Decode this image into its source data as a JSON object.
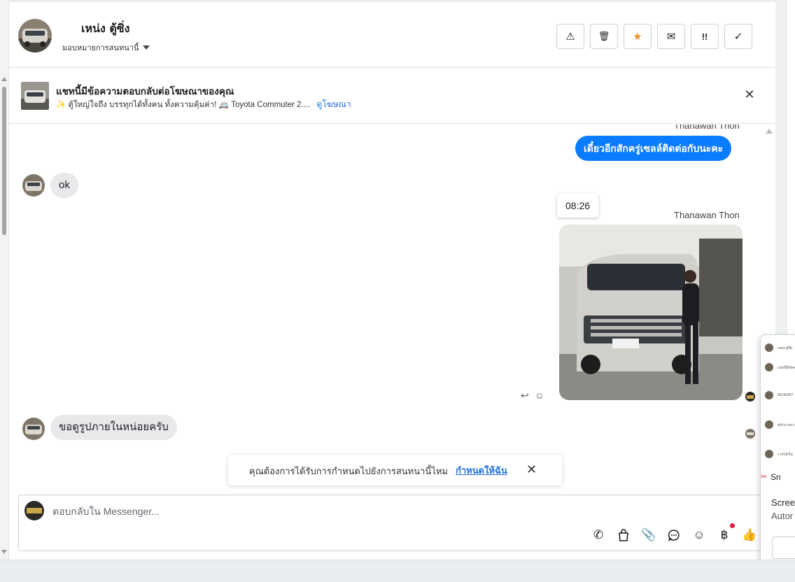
{
  "header": {
    "contact_name": "เหน่ง ตู้ซิ่ง",
    "assign_label": "มอบหมายการสนทนานี้"
  },
  "actions": {
    "spam_icon": "⚠",
    "delete_icon": "🗑",
    "star_icon": "★",
    "mark_unread_icon": "✉",
    "follow_up_icon": "!!",
    "done_icon": "✓"
  },
  "ad": {
    "title": "แชทนี้มีข้อความตอบกลับต่อโฆษณาของคุณ",
    "description": "✨ ตู้ใหญ่ใจถึง บรรทุกได้ทั้งคน ทั้งความคุ้มค่า! 🚐 Toyota Commuter 2....",
    "link": "ดูโฆษณา"
  },
  "messages": {
    "m1_sender": "Thanawan Thon",
    "m1_text": "เดี๋ยวอีกสักครู่เซลล์ติดต่อกับนะคะ",
    "m2_text": "ok",
    "m3_time": "08:26",
    "m3_sender": "Thanawan Thon",
    "m4_text": "ขอดูรูปภายในหน่อยครับ"
  },
  "assign_toast": {
    "text": "คุณต้องการได้รับการกำหนดไปยังการสนทนานี้ไหม",
    "link": "กำหนดให้ฉัน"
  },
  "composer": {
    "placeholder": "ตอบกลับใน Messenger..."
  },
  "popup": {
    "row1": "เหน่ง ตู้ซิ่ง",
    "row2": "แชทนี้มีข้อค",
    "row3": "06190067",
    "row4": "พนักงานขา",
    "row5": "รายได้เริ่ม",
    "sn_label": "Sn",
    "screen_text": "Scree",
    "auto_text": "Autor"
  },
  "colors": {
    "accent": "#0a7cff",
    "link": "#216fdb",
    "star": "#f08c2a",
    "notify_dot": "#e41e3f"
  }
}
